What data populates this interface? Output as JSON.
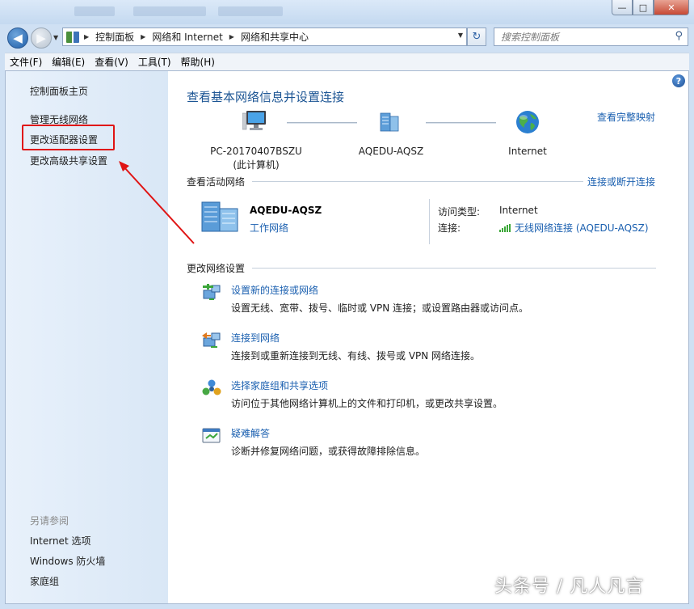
{
  "window": {
    "minimize_symbol": "—",
    "maximize_symbol": "□",
    "close_symbol": "✕"
  },
  "nav": {
    "back_symbol": "◀",
    "forward_symbol": "▶",
    "breadcrumbs": [
      "控制面板",
      "网络和 Internet",
      "网络和共享中心"
    ],
    "refresh_symbol": "↻",
    "search_placeholder": "搜索控制面板"
  },
  "menu": {
    "items": [
      "文件(F)",
      "编辑(E)",
      "查看(V)",
      "工具(T)",
      "帮助(H)"
    ]
  },
  "sidebar": {
    "links": [
      "控制面板主页",
      "管理无线网络",
      "更改适配器设置",
      "更改高级共享设置"
    ],
    "see_also_heading": "另请参阅",
    "see_also": [
      "Internet 选项",
      "Windows 防火墙",
      "家庭组"
    ]
  },
  "main": {
    "help_symbol": "?",
    "title": "查看基本网络信息并设置连接",
    "view_full_map": "查看完整映射",
    "nodes": {
      "computer_name": "PC-20170407BSZU",
      "computer_note": "(此计算机)",
      "network_name": "AQEDU-AQSZ",
      "internet_name": "Internet"
    },
    "active_section": {
      "heading": "查看活动网络",
      "connect_disconnect": "连接或断开连接",
      "network_name": "AQEDU-AQSZ",
      "network_type": "工作网络",
      "access_type_label": "访问类型:",
      "access_type_value": "Internet",
      "connection_label": "连接:",
      "connection_value": "无线网络连接 (AQEDU-AQSZ)"
    },
    "change_section": {
      "heading": "更改网络设置",
      "tasks": [
        {
          "link": "设置新的连接或网络",
          "desc": "设置无线、宽带、拨号、临时或 VPN 连接；或设置路由器或访问点。",
          "icon": "new-connection-icon"
        },
        {
          "link": "连接到网络",
          "desc": "连接到或重新连接到无线、有线、拨号或 VPN 网络连接。",
          "icon": "connect-network-icon"
        },
        {
          "link": "选择家庭组和共享选项",
          "desc": "访问位于其他网络计算机上的文件和打印机，或更改共享设置。",
          "icon": "homegroup-icon"
        },
        {
          "link": "疑难解答",
          "desc": "诊断并修复网络问题，或获得故障排除信息。",
          "icon": "troubleshoot-icon"
        }
      ]
    }
  },
  "watermark": "头条号 / 凡人凡言",
  "colors": {
    "link": "#1b60b0",
    "title": "#1c5594",
    "annotation_red": "#e01414"
  }
}
